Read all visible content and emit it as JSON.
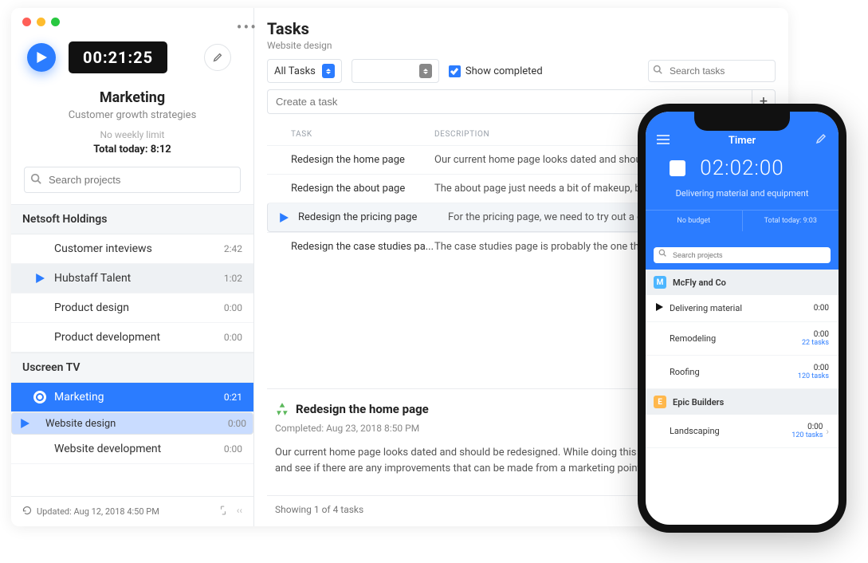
{
  "desktop": {
    "timer": "00:21:25",
    "header_title": "Marketing",
    "header_sub": "Customer growth strategies",
    "weekly_limit": "No weekly limit",
    "total_today": "Total today: 8:12",
    "search_placeholder": "Search projects",
    "footer_updated": "Updated: Aug 12, 2018 4:50 PM",
    "groups": [
      {
        "name": "Netsoft Holdings",
        "items": [
          {
            "label": "Customer inteviews",
            "time": "2:42",
            "play": false,
            "hl": false
          },
          {
            "label": "Hubstaff Talent",
            "time": "1:02",
            "play": true,
            "hl": true
          },
          {
            "label": "Product design",
            "time": "0:00",
            "play": false,
            "hl": false
          },
          {
            "label": "Product development",
            "time": "0:00",
            "play": false,
            "hl": false
          }
        ]
      },
      {
        "name": "Uscreen TV",
        "items": [
          {
            "label": "Marketing",
            "time": "0:21",
            "play": true,
            "hl": false,
            "active": true,
            "mk": true
          },
          {
            "label": "Website design",
            "time": "0:00",
            "play": true,
            "hl": false,
            "sel": true
          },
          {
            "label": "Website development",
            "time": "0:00",
            "play": false,
            "hl": false
          }
        ]
      }
    ]
  },
  "main": {
    "title": "Tasks",
    "subtitle": "Website design",
    "filter": "All Tasks",
    "show_completed_label": "Show completed",
    "search_tasks_placeholder": "Search tasks",
    "create_placeholder": "Create a task",
    "col_task": "TASK",
    "col_desc": "DESCRIPTION",
    "tasks": [
      {
        "name": "Redesign the home page",
        "desc": "Our current home page looks dated and should...",
        "sel": false,
        "play": false
      },
      {
        "name": "Redesign the about page",
        "desc": "The about page just needs a bit of makeup, bec...",
        "sel": false,
        "play": false
      },
      {
        "name": "Redesign the pricing page",
        "desc": "For the pricing page, we need to try out a differe...",
        "sel": true,
        "play": true
      },
      {
        "name": "Redesign the case studies pa...",
        "desc": "The case studies page is probably the one that ...",
        "sel": false,
        "play": false
      }
    ],
    "detail": {
      "title": "Redesign the home page",
      "completed": "Completed: Aug 23, 2018 8:50 PM",
      "body": "Our current home page looks dated and should be redesigned. While doing this we can look at each section and see if there are any improvements that can be made from a marketing point of view."
    },
    "showing": "Showing 1 of 4 tasks"
  },
  "phone": {
    "title": "Timer",
    "time": "02:02:00",
    "task": "Delivering material and equipment",
    "no_budget": "No budget",
    "total_today": "Total today: 9:03",
    "search_placeholder": "Search projects",
    "groups": [
      {
        "badge": "M",
        "cls": "sq-m",
        "name": "McFly and Co",
        "items": [
          {
            "label": "Delivering material",
            "time": "0:00",
            "tasks": "",
            "play": true
          },
          {
            "label": "Remodeling",
            "time": "0:00",
            "tasks": "22 tasks",
            "play": false
          },
          {
            "label": "Roofing",
            "time": "0:00",
            "tasks": "120 tasks",
            "play": false
          }
        ]
      },
      {
        "badge": "E",
        "cls": "sq-e",
        "name": "Epic Builders",
        "items": [
          {
            "label": "Landscaping",
            "time": "0:00",
            "tasks": "120 tasks",
            "play": false,
            "chev": true
          }
        ]
      }
    ]
  }
}
